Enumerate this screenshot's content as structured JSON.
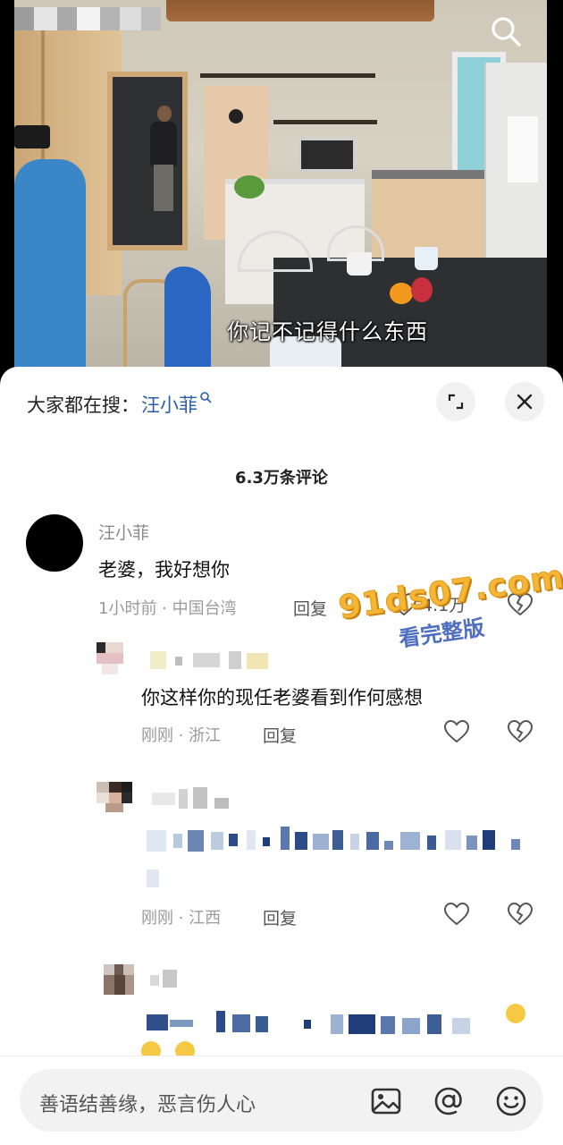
{
  "video": {
    "subtitle": "你记不记得什么东西"
  },
  "sheet": {
    "search_prefix": "大家都在搜：",
    "search_term": "汪小菲",
    "comment_count": "6.3万条评论"
  },
  "comments": [
    {
      "username": "汪小菲",
      "text": "老婆，我好想你",
      "time_location": "1小时前 · 中国台湾",
      "reply_label": "回复",
      "likes": "4.1万"
    },
    {
      "username": "",
      "text": "你这样你的现任老婆看到作何感想",
      "time_location": "刚刚 · 浙江",
      "reply_label": "回复",
      "likes": ""
    },
    {
      "username": "",
      "text": "",
      "time_location": "刚刚 · 江西",
      "reply_label": "回复",
      "likes": ""
    }
  ],
  "watermark": {
    "main": "91ds07.com",
    "sub": "看完整版"
  },
  "input": {
    "placeholder": "善语结善缘，恶言伤人心"
  },
  "icons": {
    "video_search": "search-icon",
    "expand": "expand-icon",
    "close": "close-icon",
    "like": "heart-icon",
    "dislike": "broken-heart-icon",
    "image": "image-icon",
    "mention": "at-icon",
    "emoji": "smiley-icon"
  },
  "colors": {
    "search_term": "#2a5da8",
    "watermark_main": "#f3b637",
    "watermark_sub": "#4f6ec2"
  }
}
